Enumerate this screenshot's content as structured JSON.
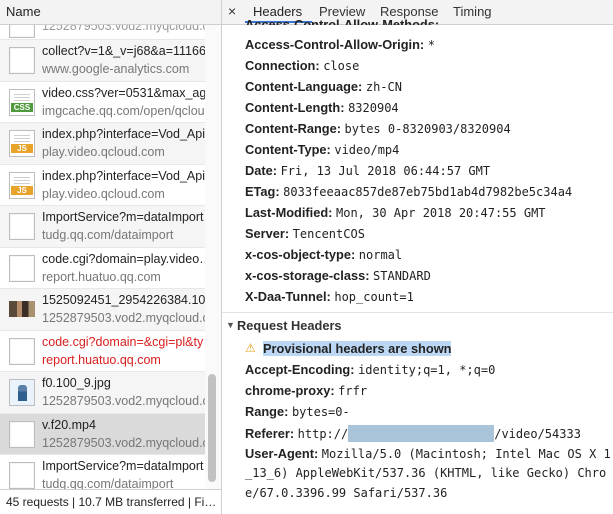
{
  "left": {
    "header": "Name",
    "rows": [
      {
        "name": "1252879503.vod2.myqcloud.com",
        "domain": "",
        "type": "doc",
        "style": "partial"
      },
      {
        "name": "collect?v=1&_v=j68&a=11166…",
        "domain": "www.google-analytics.com",
        "type": "doc",
        "style": "alt"
      },
      {
        "name": "video.css?ver=0531&max_ag…",
        "domain": "imgcache.qq.com/open/qcloud",
        "type": "css",
        "style": ""
      },
      {
        "name": "index.php?interface=Vod_Api…",
        "domain": "play.video.qcloud.com",
        "type": "js",
        "style": "alt"
      },
      {
        "name": "index.php?interface=Vod_Api…",
        "domain": "play.video.qcloud.com",
        "type": "js",
        "style": ""
      },
      {
        "name": "ImportService?m=dataImport…",
        "domain": "tudg.qq.com/dataimport",
        "type": "doc",
        "style": "alt"
      },
      {
        "name": "code.cgi?domain=play.video…",
        "domain": "report.huatuo.qq.com",
        "type": "doc",
        "style": ""
      },
      {
        "name": "1525092451_2954226384.10…",
        "domain": "1252879503.vod2.myqcloud.com",
        "type": "img1",
        "style": "alt"
      },
      {
        "name": "code.cgi?domain=&cgi=pl&ty…",
        "domain": "report.huatuo.qq.com",
        "type": "doc",
        "style": "err"
      },
      {
        "name": "f0.100_9.jpg",
        "domain": "1252879503.vod2.myqcloud.com",
        "type": "img2",
        "style": "alt"
      },
      {
        "name": "v.f20.mp4",
        "domain": "1252879503.vod2.myqcloud.com",
        "type": "doc",
        "style": "sel"
      },
      {
        "name": "ImportService?m=dataImport…",
        "domain": "tudg.qq.com/dataimport",
        "type": "doc",
        "style": ""
      }
    ],
    "footer": "45 requests | 10.7 MB transferred | Fi…"
  },
  "tabs": {
    "close": "×",
    "items": [
      "Headers",
      "Preview",
      "Response",
      "Timing"
    ],
    "active": "Headers"
  },
  "response_headers": [
    {
      "k": "Access-Control-Allow-Origin:",
      "v": "*"
    },
    {
      "k": "Connection:",
      "v": "close"
    },
    {
      "k": "Content-Language:",
      "v": "zh-CN"
    },
    {
      "k": "Content-Length:",
      "v": "8320904"
    },
    {
      "k": "Content-Range:",
      "v": "bytes 0-8320903/8320904"
    },
    {
      "k": "Content-Type:",
      "v": "video/mp4"
    },
    {
      "k": "Date:",
      "v": "Fri, 13 Jul 2018 06:44:57 GMT"
    },
    {
      "k": "ETag:",
      "v": "8033feeaac857de87eb75bd1ab4d7982be5c34a4"
    },
    {
      "k": "Last-Modified:",
      "v": "Mon, 30 Apr 2018 20:47:55 GMT"
    },
    {
      "k": "Server:",
      "v": "TencentCOS"
    },
    {
      "k": "x-cos-object-type:",
      "v": "normal"
    },
    {
      "k": "x-cos-storage-class:",
      "v": "STANDARD"
    },
    {
      "k": "X-Daa-Tunnel:",
      "v": "hop_count=1"
    }
  ],
  "request_section": {
    "arrow": "▼",
    "title": "Request Headers",
    "warning_icon": "⚠",
    "warning": "Provisional headers are shown"
  },
  "request_headers": [
    {
      "k": "Accept-Encoding:",
      "v": "identity;q=1, *;q=0"
    },
    {
      "k": "chrome-proxy:",
      "v": "frfr"
    },
    {
      "k": "Range:",
      "v": "bytes=0-"
    },
    {
      "k": "Referer:",
      "v": "http://",
      "v2": "/video/54333"
    },
    {
      "k": "User-Agent:",
      "v": "Mozilla/5.0 (Macintosh; Intel Mac OS X 10_13_6) AppleWebKit/537.36 (KHTML, like Gecko) Chrome/67.0.3396.99 Safari/537.36"
    }
  ],
  "ua_lines": [
    "Mozilla/5.0 (Macintosh; Intel Mac OS X 1",
    "_13_6) AppleWebKit/537.36 (KHTML, like Gecko) Chro",
    "e/67.0.3396.99 Safari/537.36"
  ],
  "colors": {
    "accent": "#3b73d3",
    "error": "#d9201f",
    "highlight": "#bcd7f4"
  }
}
